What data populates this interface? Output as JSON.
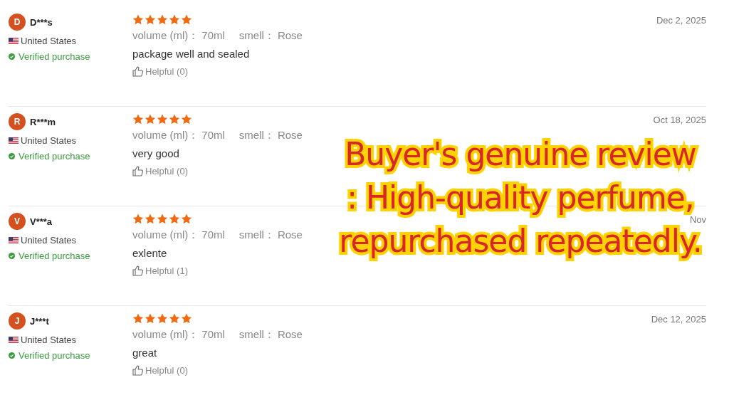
{
  "reviews": [
    {
      "avatar": "D",
      "user": "D***s",
      "country": "United States",
      "verified": "Verified purchase",
      "stars": 5,
      "attributes": [
        {
          "label": "volume (ml)：",
          "value": "70ml"
        },
        {
          "label": "smell：",
          "value": "Rose"
        }
      ],
      "text": "package well and sealed",
      "helpful": "Helpful (0)",
      "date": "Dec 2, 2025"
    },
    {
      "avatar": "R",
      "user": "R***m",
      "country": "United States",
      "verified": "Verified purchase",
      "stars": 5,
      "attributes": [
        {
          "label": "volume (ml)：",
          "value": "70ml"
        },
        {
          "label": "smell：",
          "value": "Rose"
        }
      ],
      "text": "very good",
      "helpful": "Helpful (0)",
      "date": "Oct 18, 2025"
    },
    {
      "avatar": "V",
      "user": "V***a",
      "country": "United States",
      "verified": "Verified purchase",
      "stars": 5,
      "attributes": [
        {
          "label": "volume (ml)：",
          "value": "70ml"
        },
        {
          "label": "smell：",
          "value": "Rose"
        }
      ],
      "text": "exlente",
      "helpful": "Helpful (1)",
      "date": "Nov"
    },
    {
      "avatar": "J",
      "user": "J***t",
      "country": "United States",
      "verified": "Verified purchase",
      "stars": 5,
      "attributes": [
        {
          "label": "volume (ml)：",
          "value": "70ml"
        },
        {
          "label": "smell：",
          "value": "Rose"
        }
      ],
      "text": "great",
      "helpful": "Helpful (0)",
      "date": "Dec 12, 2025"
    }
  ],
  "caption": {
    "lines": [
      "Buyer's genuine review",
      ": High-quality perfume,",
      "repurchased repeatedly."
    ]
  }
}
